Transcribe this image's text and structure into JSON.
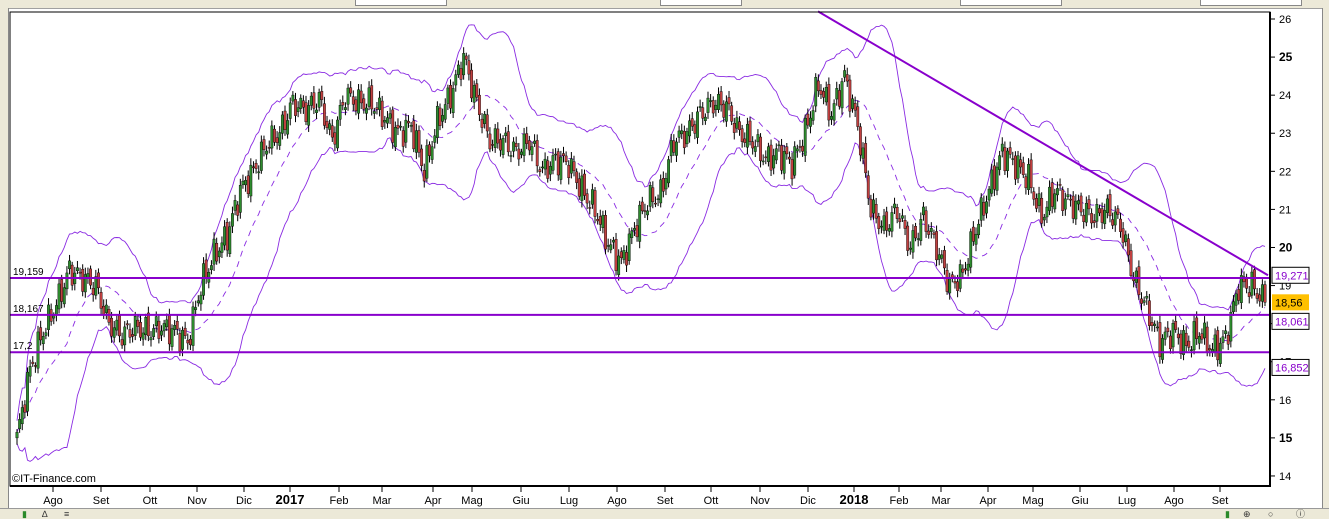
{
  "watermark": "©IT-Finance.com",
  "colors": {
    "up": "#2e8b2e",
    "down": "#c04040",
    "bands": "#8a2be2",
    "levels": "#8800cc",
    "last_price_bg": "#ffc000"
  },
  "chart_data": {
    "type": "candlestick",
    "title": "",
    "ylim": [
      14,
      26
    ],
    "y_ticks": [
      "14",
      "15",
      "16",
      "17",
      "18",
      "19",
      "20",
      "21",
      "22",
      "23",
      "24",
      "25",
      "26"
    ],
    "x_ticks": [
      "Ago",
      "Set",
      "Ott",
      "Nov",
      "Dic",
      "2017",
      "Feb",
      "Mar",
      "Apr",
      "Mag",
      "Giu",
      "Lug",
      "Ago",
      "Set",
      "Ott",
      "Nov",
      "Dic",
      "2018",
      "Feb",
      "Mar",
      "Apr",
      "Mag",
      "Giu",
      "Lug",
      "Ago",
      "Set"
    ],
    "x_range": "Jul 2016 – Sep 2018",
    "closes_approx": [
      15.0,
      16.8,
      17.8,
      18.5,
      19.4,
      19.2,
      19.0,
      18.0,
      17.7,
      17.9,
      17.8,
      17.9,
      17.8,
      17.5,
      19.0,
      19.8,
      20.3,
      21.5,
      22.0,
      22.7,
      23.0,
      23.8,
      23.6,
      23.9,
      22.8,
      24.0,
      23.8,
      23.8,
      23.4,
      23.0,
      23.2,
      22.0,
      23.3,
      24.0,
      25.0,
      23.8,
      22.8,
      22.8,
      22.5,
      22.8,
      22.0,
      22.3,
      22.2,
      21.5,
      21.0,
      20.1,
      19.6,
      20.5,
      21.2,
      21.4,
      22.8,
      23.0,
      23.5,
      23.8,
      23.7,
      23.0,
      22.8,
      22.3,
      22.5,
      22.2,
      23.0,
      24.3,
      23.5,
      24.5,
      23.2,
      21.0,
      20.5,
      21.0,
      20.0,
      20.8,
      20.0,
      19.0,
      19.3,
      20.5,
      21.5,
      22.5,
      22.2,
      21.8,
      20.8,
      21.5,
      21.2,
      21.0,
      20.8,
      21.0,
      20.6,
      19.2,
      18.4,
      17.5,
      17.8,
      17.4,
      17.8,
      17.3,
      17.6,
      19.0,
      19.0,
      18.56
    ],
    "indicators": {
      "bollinger": {
        "period": 20,
        "std": 2
      }
    },
    "horizontal_levels": [
      {
        "label": "19,159",
        "value": 19.2
      },
      {
        "label": "18,167",
        "value": 18.23
      },
      {
        "label": "17,2",
        "value": 17.25
      }
    ],
    "trendline": {
      "from": {
        "time": "Nov 2017",
        "value": 26.2
      },
      "to": {
        "time": "Sep 2018",
        "value": 19.27
      }
    },
    "right_labels": [
      {
        "label": "19,271",
        "value": 19.27,
        "kind": "upper"
      },
      {
        "label": "18,56",
        "value": 18.56,
        "kind": "last"
      },
      {
        "label": "18,061",
        "value": 18.06,
        "kind": "middle"
      },
      {
        "label": "16,852",
        "value": 16.85,
        "kind": "lower"
      }
    ],
    "legend": "none"
  }
}
